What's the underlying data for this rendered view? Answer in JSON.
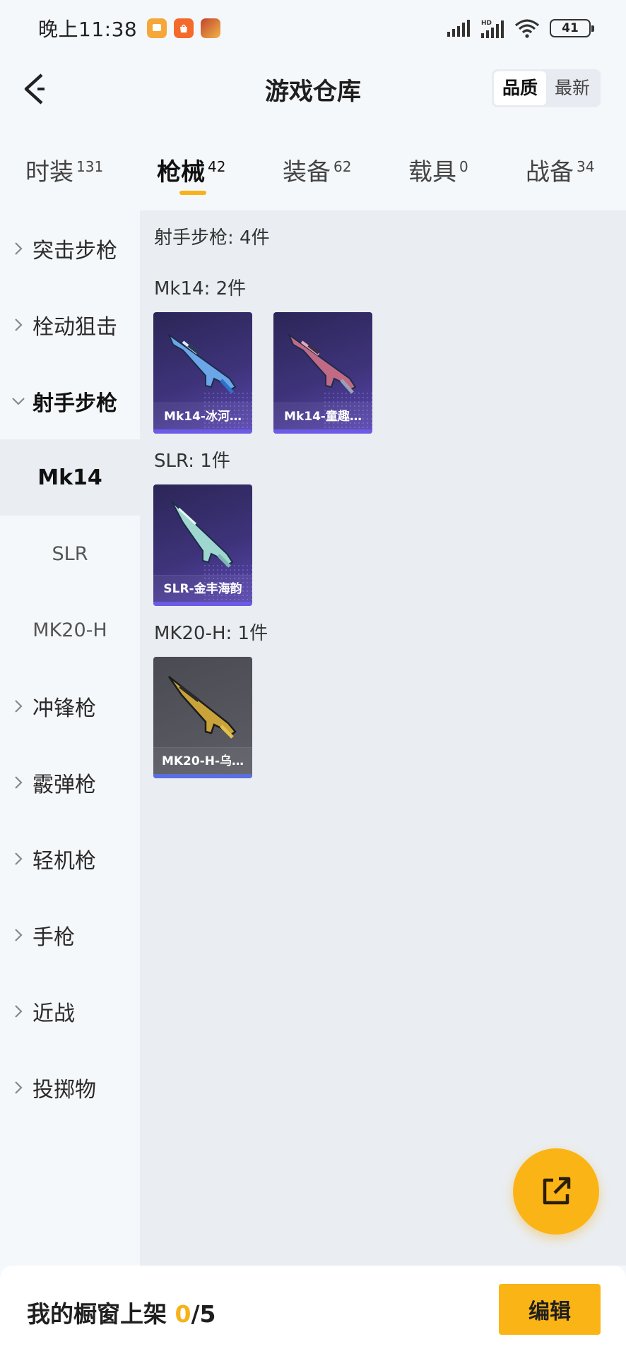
{
  "status_bar": {
    "time": "晚上11:38",
    "battery": "41",
    "app_icons": [
      "message-app-icon",
      "mi-store-app-icon",
      "game-app-icon"
    ]
  },
  "header": {
    "title": "游戏仓库",
    "sort_options": [
      "品质",
      "最新"
    ],
    "active_sort": "品质"
  },
  "tabs": [
    {
      "label": "时装",
      "count": "131"
    },
    {
      "label": "枪械",
      "count": "42"
    },
    {
      "label": "装备",
      "count": "62"
    },
    {
      "label": "载具",
      "count": "0"
    },
    {
      "label": "战备",
      "count": "34"
    }
  ],
  "active_tab": "枪械",
  "sidebar": {
    "items": [
      {
        "label": "突击步枪"
      },
      {
        "label": "栓动狙击"
      },
      {
        "label": "射手步枪"
      },
      {
        "label": "冲锋枪"
      },
      {
        "label": "霰弹枪"
      },
      {
        "label": "轻机枪"
      },
      {
        "label": "手枪"
      },
      {
        "label": "近战"
      },
      {
        "label": "投掷物"
      }
    ],
    "sub_items": [
      {
        "label": "Mk14"
      },
      {
        "label": "SLR"
      },
      {
        "label": "MK20-H"
      }
    ],
    "active_sub": "Mk14"
  },
  "content": {
    "category_summary": "射手步枪: 4件",
    "groups": [
      {
        "title": "Mk14: 2件",
        "items": [
          {
            "caption": "Mk14-冰河…",
            "rarity": "purple"
          },
          {
            "caption": "Mk14-童趣…",
            "rarity": "purple"
          }
        ]
      },
      {
        "title": "SLR: 1件",
        "items": [
          {
            "caption": "SLR-金丰海韵",
            "rarity": "purple"
          }
        ]
      },
      {
        "title": "MK20-H: 1件",
        "items": [
          {
            "caption": "MK20-H-乌…",
            "rarity": "grey"
          }
        ]
      }
    ]
  },
  "bottom_bar": {
    "label": "我的橱窗上架",
    "current": "0",
    "total": "/5",
    "edit_label": "编辑"
  },
  "colors": {
    "accent": "#fbb415",
    "sidebar_bg": "#f5f8fb",
    "content_bg": "#eaeef2"
  }
}
